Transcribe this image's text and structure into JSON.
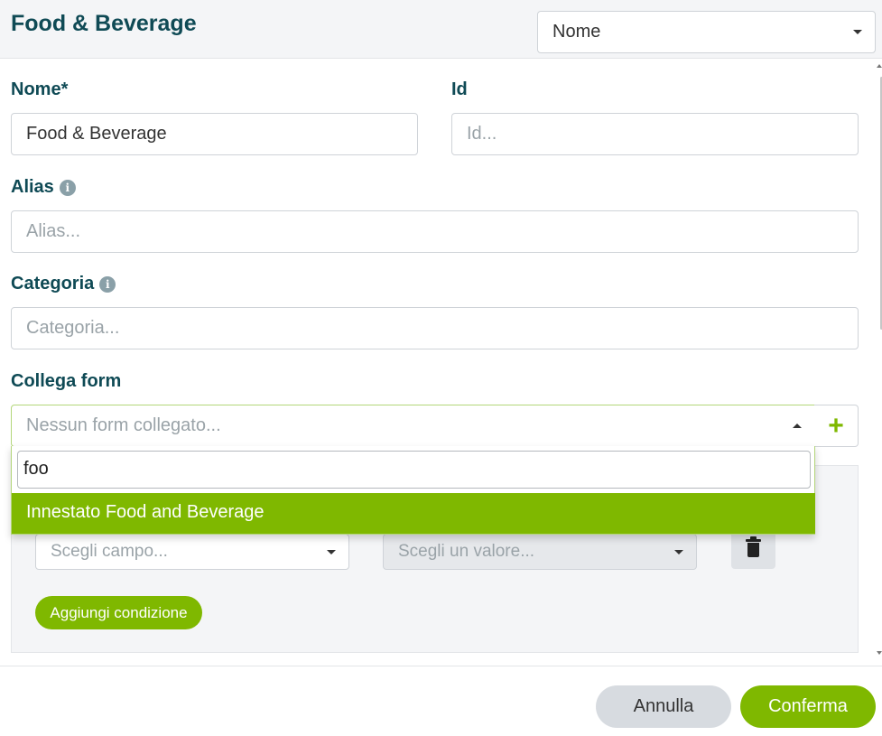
{
  "header": {
    "title": "Food & Beverage",
    "language_select": {
      "selected": "Nome"
    }
  },
  "form": {
    "nome": {
      "label": "Nome*",
      "value": "Food & Beverage"
    },
    "id": {
      "label": "Id",
      "placeholder": "Id..."
    },
    "alias": {
      "label": "Alias",
      "placeholder": "Alias..."
    },
    "categoria": {
      "label": "Categoria",
      "placeholder": "Categoria..."
    },
    "collega_form": {
      "label": "Collega form",
      "placeholder": "Nessun form collegato...",
      "search_value": "foo",
      "options": [
        "Innestato Food and Beverage"
      ]
    }
  },
  "conditions": {
    "field_placeholder": "Scegli campo...",
    "value_placeholder": "Scegli un valore...",
    "add_label": "Aggiungi condizione"
  },
  "footer": {
    "cancel_label": "Annulla",
    "confirm_label": "Conferma"
  },
  "icons": {
    "info": "info-icon",
    "plus": "+",
    "trash": "trash-icon"
  },
  "colors": {
    "accent": "#7fb800",
    "title": "#0f4a55",
    "header_bg": "#f4f5f7"
  }
}
